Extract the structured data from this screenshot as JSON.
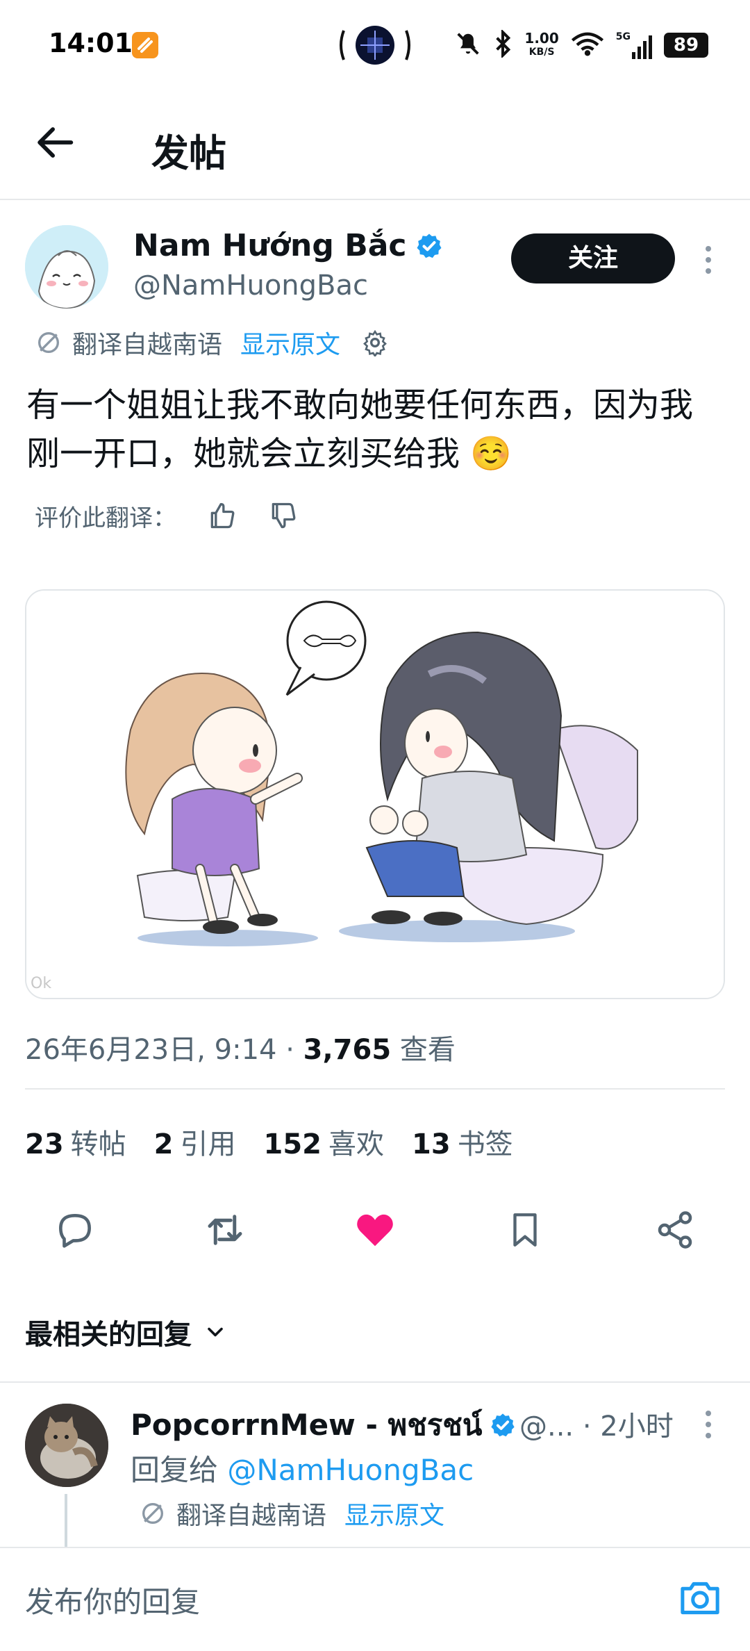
{
  "status_bar": {
    "time": "14:01",
    "net_speed_value": "1.00",
    "net_speed_unit": "KB/S",
    "network": "5G",
    "battery": "89"
  },
  "header": {
    "title": "发帖"
  },
  "post": {
    "author_name": "Nam Hướng Bắc",
    "author_handle": "@NamHuongBac",
    "follow_label": "关注",
    "translated_from": "翻译自越南语",
    "show_original": "显示原文",
    "text": "有一个姐姐让我不敢向她要任何东西，因为我刚一开口，她就会立刻买给我 ☺️",
    "rate_translation": "评价此翻译：",
    "date": "26年6月23日, 9:14",
    "views_count": "3,765",
    "views_label": "查看",
    "stats": [
      {
        "count": "23",
        "label": "转帖"
      },
      {
        "count": "2",
        "label": "引用"
      },
      {
        "count": "152",
        "label": "喜欢"
      },
      {
        "count": "13",
        "label": "书签"
      }
    ],
    "liked": true,
    "like_color": "#f91880",
    "accent_color": "#1d9bf0",
    "media_watermark": "Ok"
  },
  "replies_section": {
    "sort_label": "最相关的回复"
  },
  "reply": {
    "author_name": "PopcorrnMew - พชรชน์",
    "author_handle": "@...",
    "time": "· 2小时",
    "reply_to_prefix": "回复给",
    "reply_to_handle": "@NamHuongBac",
    "translated_from": "翻译自越南语",
    "show_original": "显示原文"
  },
  "compose": {
    "placeholder": "发布你的回复"
  }
}
